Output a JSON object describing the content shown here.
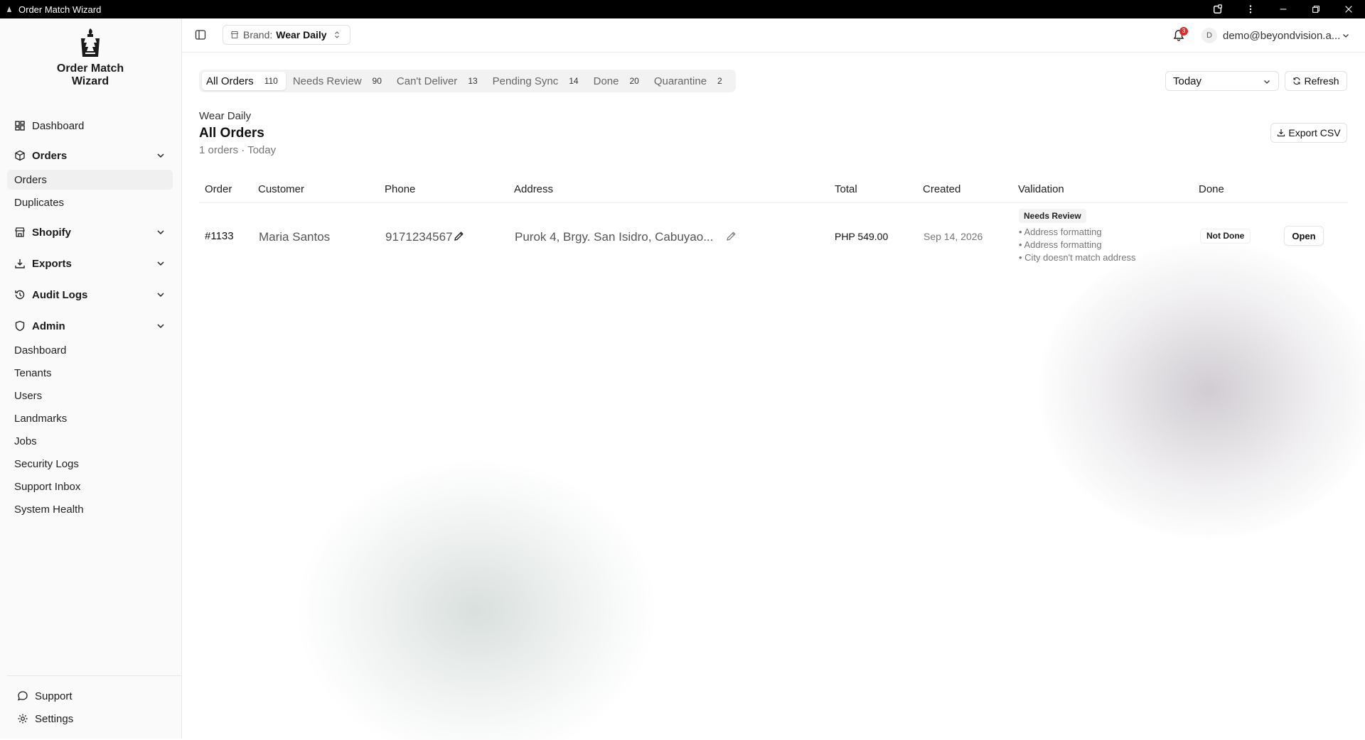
{
  "window": {
    "title": "Order Match Wizard"
  },
  "logo": {
    "line1": "Order Match",
    "line2": "Wizard"
  },
  "sidebar": {
    "dashboard": "Dashboard",
    "orders": {
      "label": "Orders",
      "items": [
        "Orders",
        "Duplicates"
      ]
    },
    "shopify": "Shopify",
    "exports": "Exports",
    "audit_logs": "Audit Logs",
    "admin": {
      "label": "Admin",
      "items": [
        "Dashboard",
        "Tenants",
        "Users",
        "Landmarks",
        "Jobs",
        "Security Logs",
        "Support Inbox",
        "System Health"
      ]
    },
    "support": "Support",
    "settings": "Settings"
  },
  "header": {
    "brand_label": "Brand:",
    "brand_value": "Wear Daily",
    "notification_count": "3",
    "user_initial": "D",
    "user_email": "demo@beyondvision.a..."
  },
  "tabs": [
    {
      "label": "All Orders",
      "count": "110"
    },
    {
      "label": "Needs Review",
      "count": "90"
    },
    {
      "label": "Can't Deliver",
      "count": "13"
    },
    {
      "label": "Pending Sync",
      "count": "14"
    },
    {
      "label": "Done",
      "count": "20"
    },
    {
      "label": "Quarantine",
      "count": "2"
    }
  ],
  "filters": {
    "date_range": "Today",
    "refresh_label": "Refresh",
    "export_label": "Export CSV"
  },
  "page": {
    "breadcrumb": "Wear Daily",
    "title": "All Orders",
    "subtitle": "1 orders · Today"
  },
  "table": {
    "columns": [
      "Order",
      "Customer",
      "Phone",
      "Address",
      "Total",
      "Created",
      "Validation",
      "Done"
    ],
    "rows": [
      {
        "order": "#1133",
        "customer": "Maria Santos",
        "phone": "9171234567",
        "address": "Purok 4, Brgy. San Isidro, Cabuyao...",
        "total": "PHP 549.00",
        "created": "Sep 14, 2026",
        "validation_status": "Needs Review",
        "issues": [
          "• Address formatting",
          "• Address formatting",
          "• City doesn't match address"
        ],
        "done": "Not Done",
        "action": "Open"
      }
    ]
  }
}
